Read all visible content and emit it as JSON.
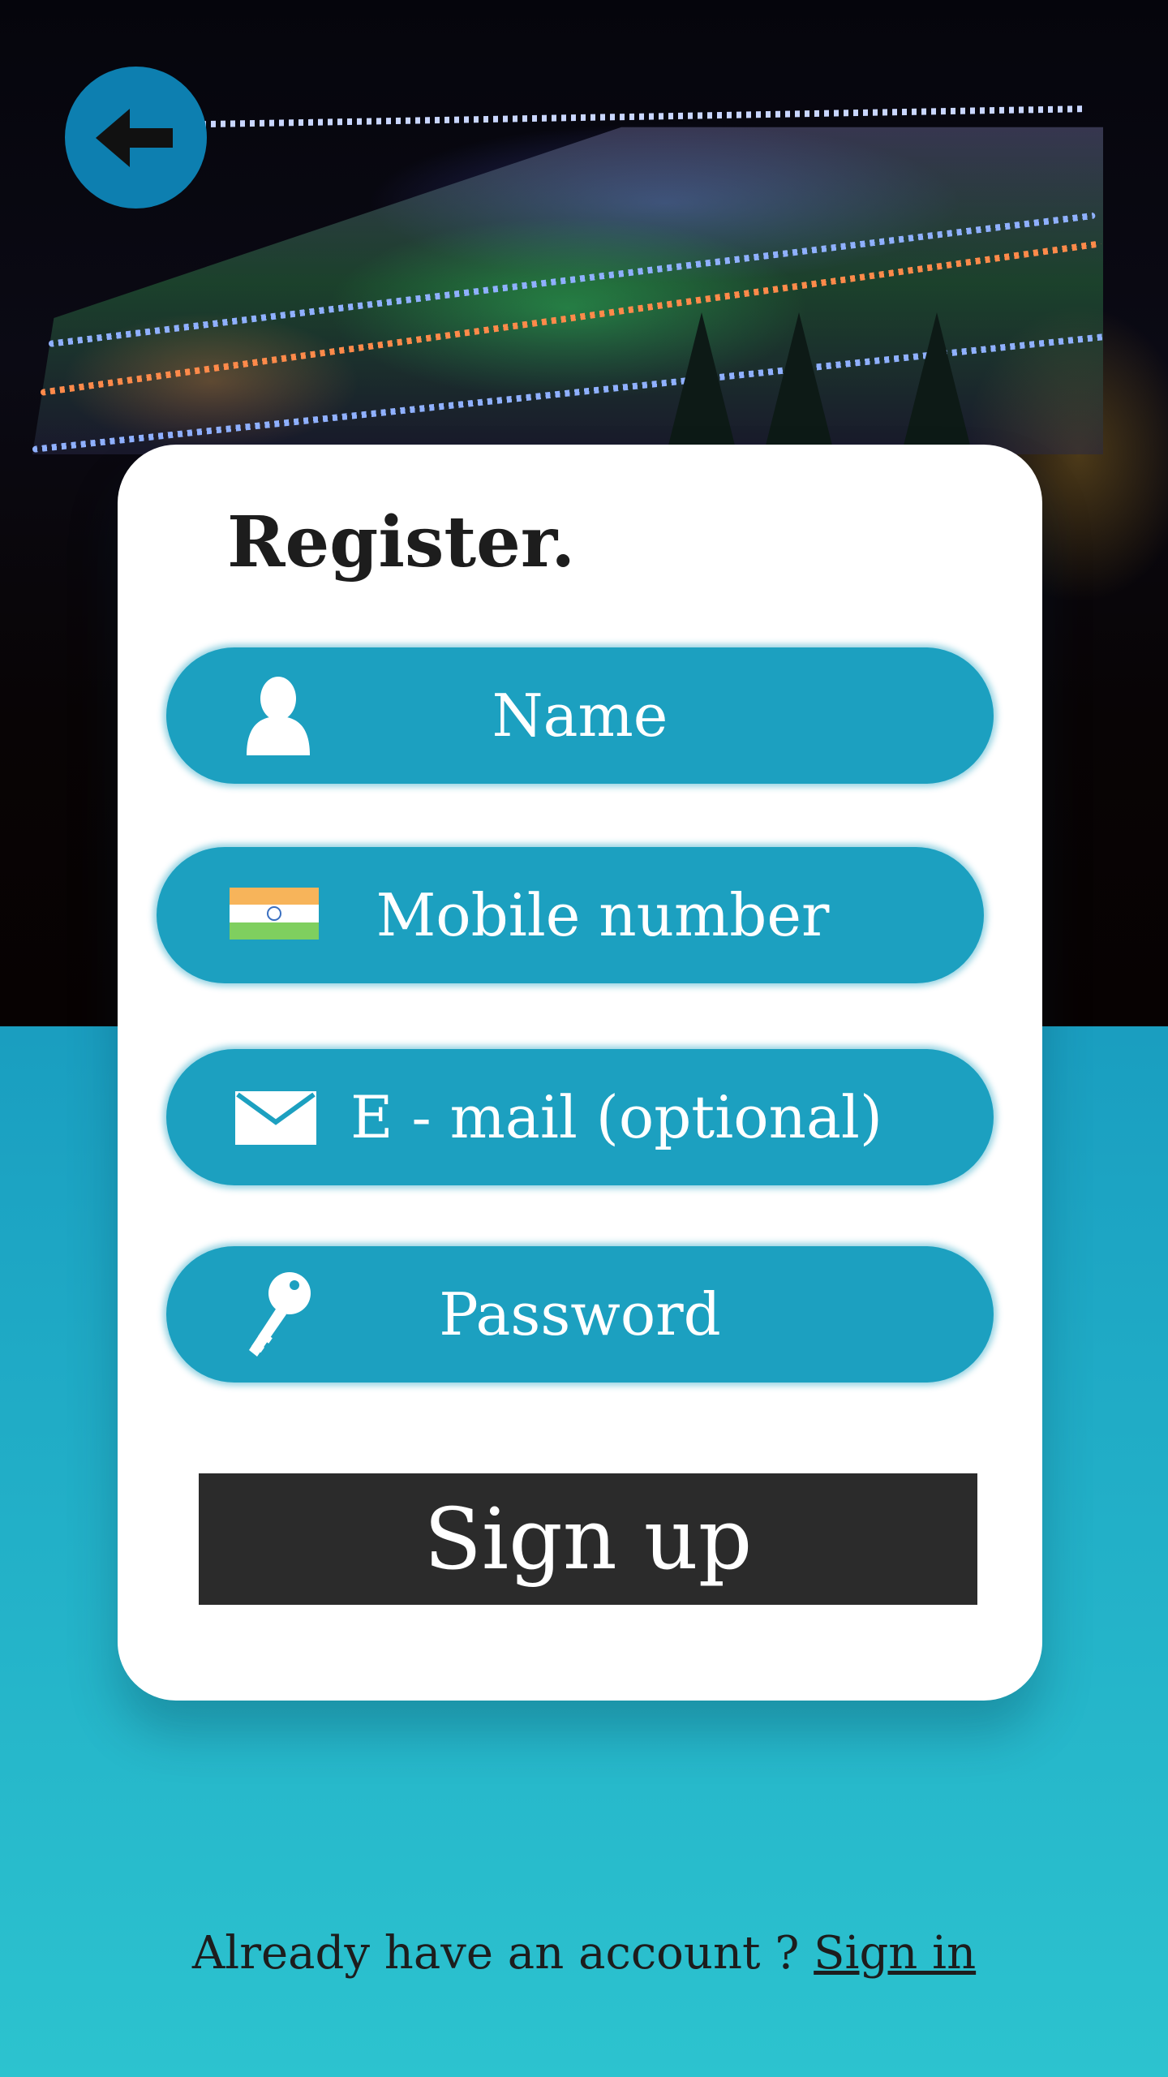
{
  "card": {
    "title": "Register."
  },
  "fields": {
    "name": {
      "placeholder": "Name",
      "icon": "person-icon"
    },
    "mobile": {
      "placeholder": "Mobile number",
      "icon": "india-flag-icon"
    },
    "email": {
      "placeholder": "E - mail (optional)",
      "icon": "envelope-icon"
    },
    "password": {
      "placeholder": "Password",
      "icon": "key-icon"
    }
  },
  "buttons": {
    "back": {
      "icon": "back-arrow-icon"
    },
    "signup_label": "Sign up"
  },
  "footer": {
    "prompt": "Already have an account ?",
    "link_label": "Sign in"
  },
  "colors": {
    "field_bg": "#1ca0c0",
    "back_button": "#0d7fb0",
    "signup_bg": "#2b2b2b",
    "gradient_top": "#0a78ad",
    "gradient_bottom": "#2cc3cf"
  }
}
